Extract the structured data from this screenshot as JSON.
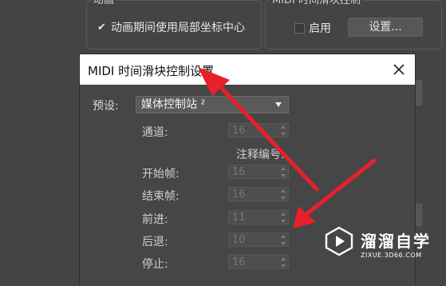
{
  "background_panel": {
    "animation_group": {
      "title": "动画",
      "checkbox_label": "动画期间使用局部坐标中心",
      "checked": true
    },
    "midi_group": {
      "title": "MIDI 时间滑块控制",
      "enable_label": "启用",
      "enable_checked": false,
      "settings_button": "设置..."
    }
  },
  "dialog": {
    "title": "MIDI 时间滑块控制设置",
    "close_icon": "close-icon",
    "preset": {
      "label": "预设:",
      "value": "媒体控制站 ²"
    },
    "notes_label": "注释编号:",
    "fields": [
      {
        "label": "通道:",
        "value": "16"
      },
      {
        "label": "开始帧:",
        "value": "16"
      },
      {
        "label": "结束帧:",
        "value": "16"
      },
      {
        "label": "前进:",
        "value": "11"
      },
      {
        "label": "后退:",
        "value": "10"
      },
      {
        "label": "停止:",
        "value": "16"
      }
    ]
  },
  "annotations": {
    "arrow_color": "#e8202a"
  },
  "watermark": {
    "logo_icon": "play-logo-icon",
    "title": "溜溜自学",
    "subtitle": "ZIXUE.3D66.COM"
  }
}
